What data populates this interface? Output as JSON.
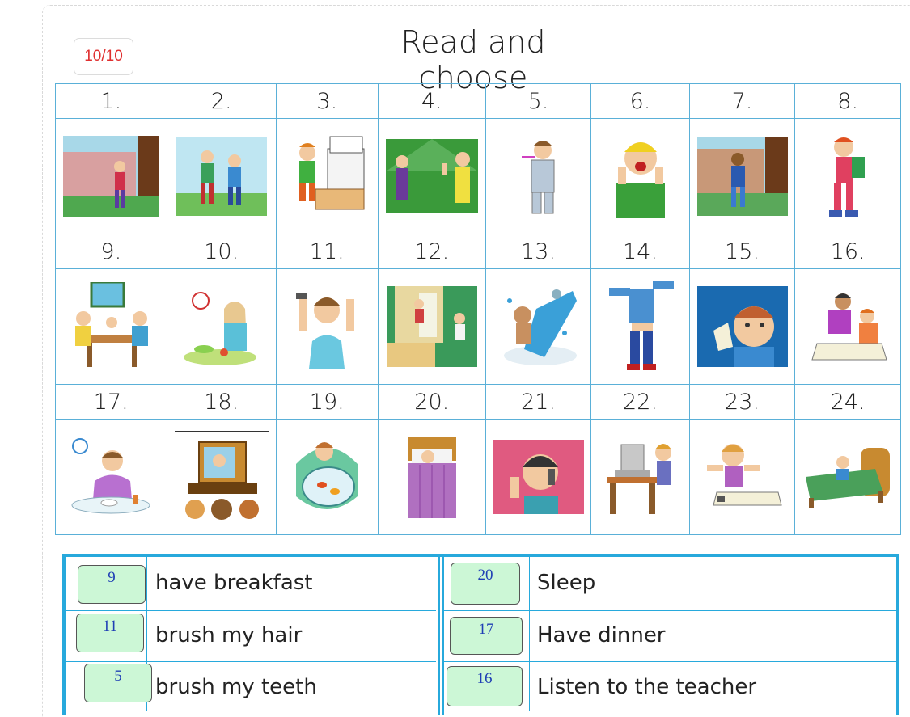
{
  "score": "10/10",
  "title": "Read and choose",
  "grid": {
    "rows": [
      {
        "numbers": [
          "1.",
          "2.",
          "3.",
          "4.",
          "5.",
          "6.",
          "7.",
          "8."
        ],
        "pictures": [
          "girl-leaving-house",
          "boys-walking",
          "boy-making-bed",
          "kids-waving-goodbye",
          "boy-brushing-teeth",
          "boy-waking-up",
          "boy-entering-house",
          "boy-going-to-school"
        ]
      },
      {
        "numbers": [
          "9.",
          "10.",
          "11.",
          "12.",
          "13.",
          "14.",
          "15.",
          "16."
        ],
        "pictures": [
          "family-at-breakfast",
          "girl-eating-lunch",
          "boy-brushing-hair",
          "boy-coming-home",
          "man-taking-shower",
          "boy-getting-dressed",
          "boy-eating-sandwich",
          "teacher-helping-student"
        ]
      },
      {
        "numbers": [
          "17.",
          "18.",
          "19.",
          "20.",
          "21.",
          "22.",
          "23.",
          "24."
        ],
        "pictures": [
          "man-having-dinner",
          "family-watching-tv",
          "girl-feeding-fish",
          "girl-sleeping",
          "boy-on-phone",
          "boy-at-computer",
          "boy-doing-homework",
          "boy-going-to-bed"
        ]
      }
    ]
  },
  "answers": [
    {
      "value": "9",
      "text": "have breakfast"
    },
    {
      "value": "20",
      "text": "Sleep"
    },
    {
      "value": "11",
      "text": "brush my hair"
    },
    {
      "value": "17",
      "text": "Have dinner"
    },
    {
      "value": "5",
      "text": "brush my teeth"
    },
    {
      "value": "16",
      "text": "Listen to the teacher"
    }
  ],
  "colors": {
    "grid_border": "#5ab0d8",
    "answer_border": "#27a9dc",
    "answer_box_fill": "#ccf7d6",
    "answer_value": "#1f3fb5",
    "score_text": "#e03030"
  }
}
